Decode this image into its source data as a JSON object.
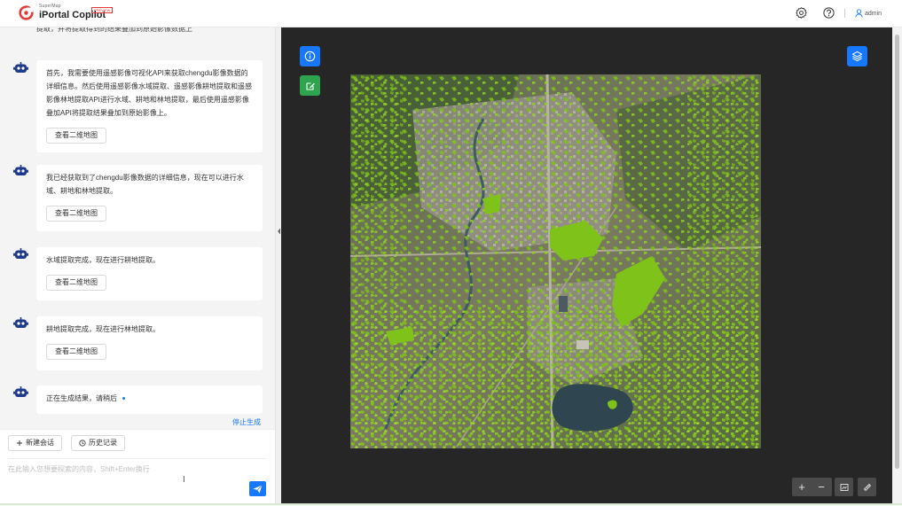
{
  "header": {
    "brand_small": "SuperMap",
    "title": "iPortal Copilot",
    "badge": "PREVIEW",
    "user_name": "admin"
  },
  "chat": {
    "truncated_text": "提取，并将提取得到的结果叠加到原始影像数据上",
    "messages": [
      {
        "text": "首先，我需要使用遥感影像可视化API来获取chengdu影像数据的详细信息。然后使用遥感影像水域提取、遥感影像耕地提取和遥感影像林地提取API进行水域、耕地和林地提取，最后使用遥感影像叠加API将提取结果叠加到原始影像上。",
        "button": "查看二维地图"
      },
      {
        "text": "我已经获取到了chengdu影像数据的详细信息，现在可以进行水域、耕地和林地提取。",
        "button": "查看二维地图"
      },
      {
        "text": "水域提取完成，现在进行耕地提取。",
        "button": "查看二维地图"
      },
      {
        "text": "耕地提取完成，现在进行林地提取。",
        "button": "查看二维地图"
      },
      {
        "text": "正在生成结果，请稍后"
      }
    ],
    "stop_label": "停止生成"
  },
  "input_area": {
    "new_chat_label": "新建会话",
    "history_label": "历史记录",
    "placeholder": "在此输入您想要探索的内容，Shift+Enter换行"
  },
  "map": {
    "zoom_in": "+",
    "zoom_out": "−"
  },
  "colors": {
    "primary": "#1677ff",
    "edit_green": "#2ea44f",
    "map_bg": "#262626",
    "extraction_green": "#7fc21a"
  }
}
